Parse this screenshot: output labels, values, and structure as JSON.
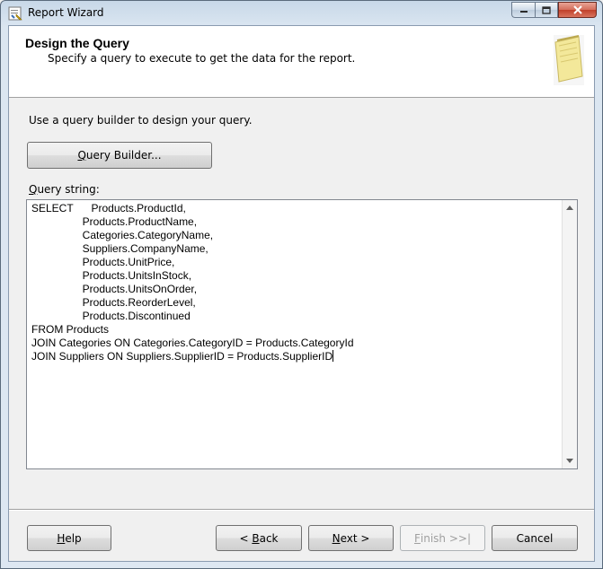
{
  "window": {
    "title": "Report Wizard"
  },
  "header": {
    "title": "Design the Query",
    "subtitle": "Specify a query to execute to get the data for the report."
  },
  "intro": "Use a query builder to design your query.",
  "query_builder_button": {
    "mnemonic": "Q",
    "rest": "uery Builder..."
  },
  "query_string_label": {
    "mnemonic": "Q",
    "rest": "uery string:"
  },
  "query_lines": [
    "SELECT      Products.ProductId,",
    "                 Products.ProductName,",
    "                 Categories.CategoryName,",
    "                 Suppliers.CompanyName,",
    "                 Products.UnitPrice,",
    "                 Products.UnitsInStock,",
    "                 Products.UnitsOnOrder,",
    "                 Products.ReorderLevel,",
    "                 Products.Discontinued",
    "FROM Products",
    "JOIN Categories ON Categories.CategoryID = Products.CategoryId",
    "JOIN Suppliers ON Suppliers.SupplierID = Products.SupplierID"
  ],
  "buttons": {
    "help": {
      "mnemonic": "H",
      "rest": "elp"
    },
    "back": {
      "prefix": "< ",
      "mnemonic": "B",
      "rest": "ack"
    },
    "next": {
      "mnemonic": "N",
      "rest": "ext >"
    },
    "finish": {
      "mnemonic": "F",
      "rest": "inish >>|"
    },
    "cancel": "Cancel"
  },
  "colors": {
    "accent": "#4a6a94",
    "close": "#c0402a"
  }
}
